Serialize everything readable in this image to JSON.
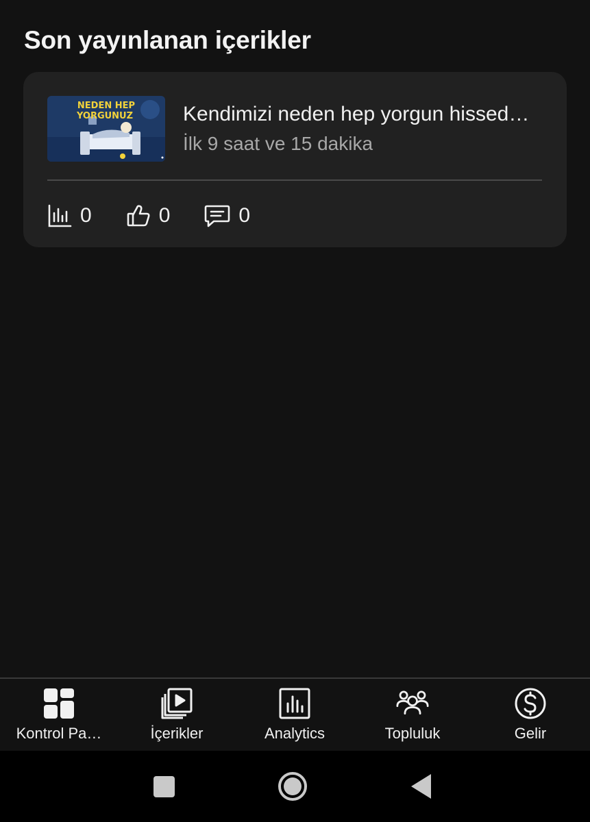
{
  "section": {
    "title": "Son yayınlanan içerikler"
  },
  "video": {
    "title": "Kendimizi neden hep yorgun hissed…",
    "subtitle": "İlk 9 saat ve 15 dakika",
    "thumbnail": {
      "text_line1": "NEDEN HEP",
      "text_line2": "YORGUNUZ",
      "colors": {
        "background": "#1e3a66",
        "text": "#f2d23a"
      }
    },
    "stats": {
      "views": "0",
      "likes": "0",
      "comments": "0"
    },
    "icons": {
      "views": "bar-chart-icon",
      "likes": "thumbs-up-icon",
      "comments": "comment-icon"
    }
  },
  "bottom_nav": {
    "items": [
      {
        "label": "Kontrol Pa…",
        "icon": "dashboard-icon"
      },
      {
        "label": "İçerikler",
        "icon": "content-library-icon"
      },
      {
        "label": "Analytics",
        "icon": "analytics-icon"
      },
      {
        "label": "Topluluk",
        "icon": "community-icon"
      },
      {
        "label": "Gelir",
        "icon": "dollar-icon"
      }
    ]
  },
  "system_nav": {
    "buttons": [
      "recents-button",
      "home-button",
      "back-button"
    ]
  },
  "colors": {
    "background": "#121212",
    "card": "#212121",
    "text_primary": "#f1f1f1",
    "text_secondary": "#a8a8a8"
  }
}
